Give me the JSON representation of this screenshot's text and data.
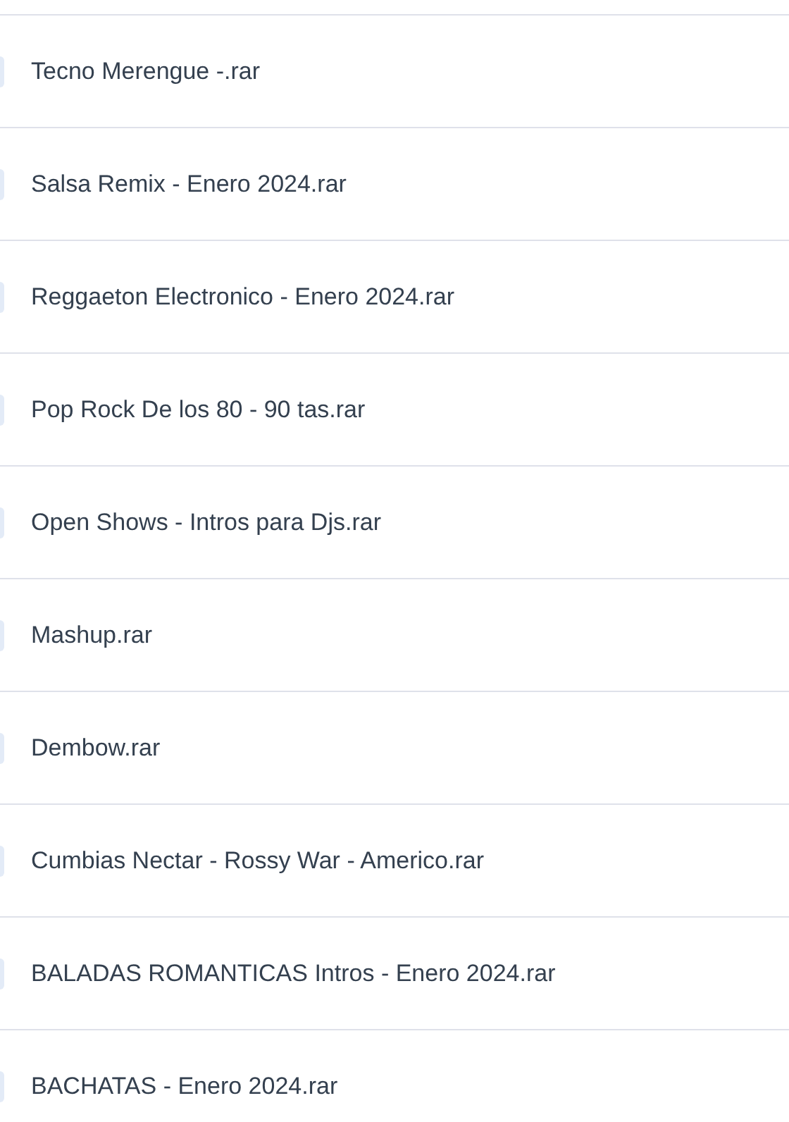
{
  "files": [
    {
      "name": "Tecno Merengue -.rar"
    },
    {
      "name": "Salsa Remix - Enero 2024.rar"
    },
    {
      "name": "Reggaeton Electronico - Enero 2024.rar"
    },
    {
      "name": "Pop Rock De los 80 - 90 tas.rar"
    },
    {
      "name": "Open Shows - Intros para Djs.rar"
    },
    {
      "name": "Mashup.rar"
    },
    {
      "name": "Dembow.rar"
    },
    {
      "name": "Cumbias Nectar - Rossy War - Americo.rar"
    },
    {
      "name": "BALADAS ROMANTICAS Intros - Enero 2024.rar"
    },
    {
      "name": "BACHATAS - Enero 2024.rar"
    }
  ]
}
